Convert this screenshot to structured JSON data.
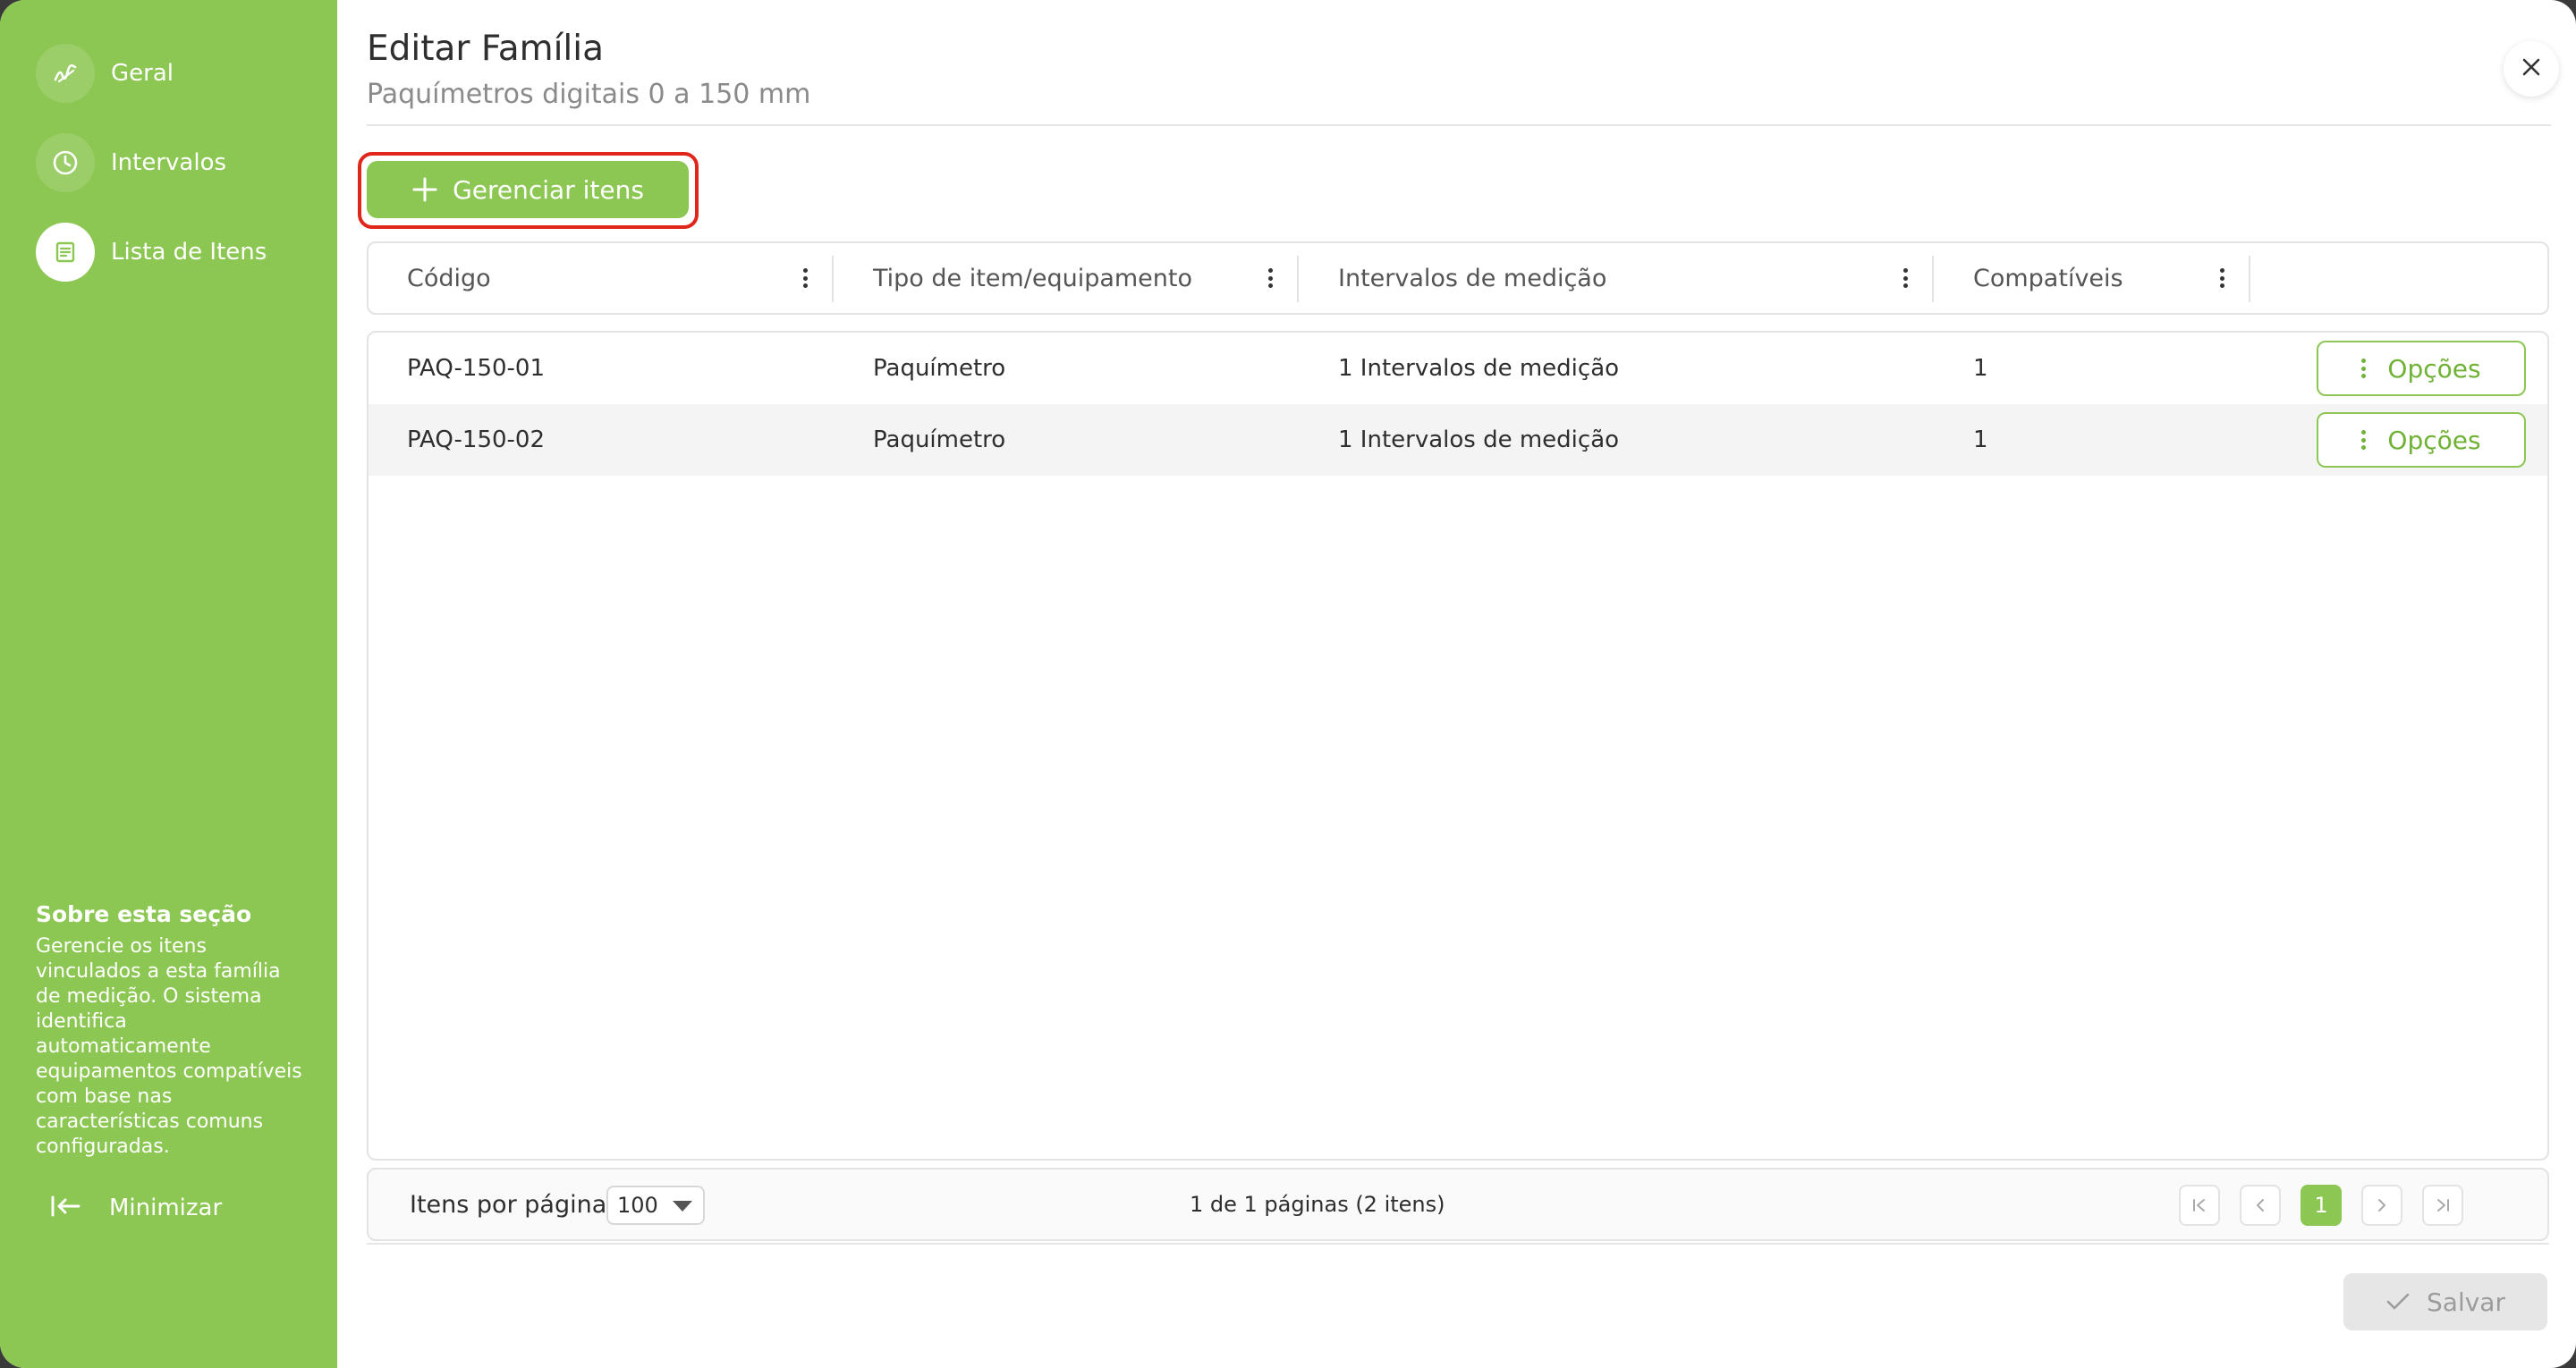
{
  "sidebar": {
    "items": [
      {
        "label": "Geral",
        "icon": "wave-icon"
      },
      {
        "label": "Intervalos",
        "icon": "clock-icon"
      },
      {
        "label": "Lista de Itens",
        "icon": "list-icon",
        "active": true
      }
    ],
    "about": {
      "title": "Sobre esta seção",
      "text": "Gerencie os itens vinculados a esta família de medição. O sistema identifica automaticamente equipamentos compatíveis com base nas características comuns configuradas."
    },
    "minimize_label": "Minimizar"
  },
  "header": {
    "title": "Editar Família",
    "subtitle": "Paquímetros digitais 0 a 150 mm"
  },
  "toolbar": {
    "manage_label": "Gerenciar itens"
  },
  "table": {
    "columns": [
      "Código",
      "Tipo de item/equipamento",
      "Intervalos de medição",
      "Compatíveis"
    ],
    "rows": [
      {
        "code": "PAQ-150-01",
        "type": "Paquímetro",
        "intervals": "1 Intervalos de medição",
        "compatible": "1",
        "action": "Opções"
      },
      {
        "code": "PAQ-150-02",
        "type": "Paquímetro",
        "intervals": "1 Intervalos de medição",
        "compatible": "1",
        "action": "Opções"
      }
    ]
  },
  "pagination": {
    "per_page_label": "Itens por página",
    "per_page_value": "100",
    "info": "1 de 1 páginas (2 itens)",
    "current_page": "1"
  },
  "footer": {
    "save_label": "Salvar"
  },
  "colors": {
    "accent": "#8dc753",
    "highlight": "#e0261b",
    "disabled": "#e6e6e6"
  }
}
